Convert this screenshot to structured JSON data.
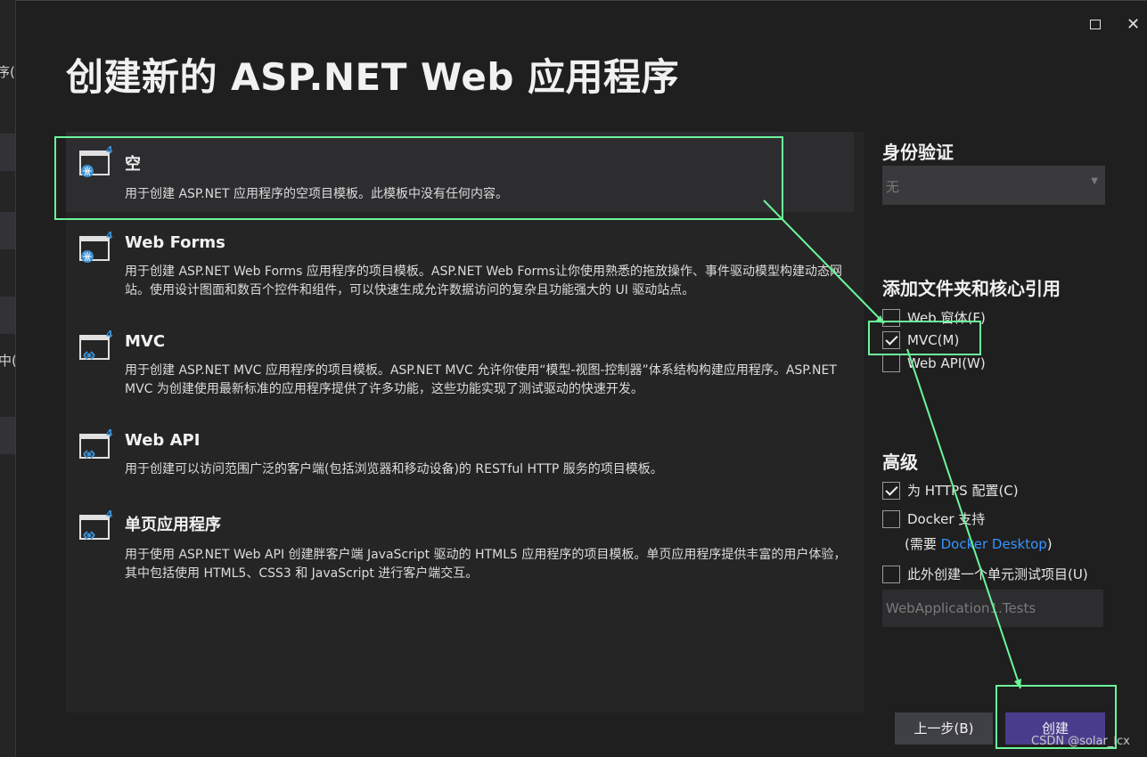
{
  "background_window": {
    "fragments": [
      "序(",
      "中("
    ]
  },
  "window_controls": {
    "maximize": "maximize-icon",
    "close": "✕"
  },
  "title": "创建新的 ASP.NET Web 应用程序",
  "templates": [
    {
      "name": "空",
      "desc": "用于创建 ASP.NET 应用程序的空项目模板。此模板中没有任何内容。",
      "selected": true
    },
    {
      "name": "Web Forms",
      "desc": "用于创建 ASP.NET Web Forms 应用程序的项目模板。ASP.NET Web Forms让你使用熟悉的拖放操作、事件驱动模型构建动态网站。使用设计图面和数百个控件和组件，可以快速生成允许数据访问的复杂且功能强大的 UI 驱动站点。"
    },
    {
      "name": "MVC",
      "desc": "用于创建 ASP.NET MVC 应用程序的项目模板。ASP.NET MVC 允许你使用“模型-视图-控制器”体系结构构建应用程序。ASP.NET MVC 为创建使用最新标准的应用程序提供了许多功能，这些功能实现了测试驱动的快速开发。"
    },
    {
      "name": "Web API",
      "desc": "用于创建可以访问范围广泛的客户端(包括浏览器和移动设备)的 RESTful HTTP 服务的项目模板。"
    },
    {
      "name": "单页应用程序",
      "desc": "用于使用 ASP.NET Web API 创建胖客户端 JavaScript 驱动的 HTML5 应用程序的项目模板。单页应用程序提供丰富的用户体验，其中包括使用 HTML5、CSS3 和 JavaScript 进行客户端交互。"
    }
  ],
  "template_icon_badge": "4",
  "auth": {
    "heading": "身份验证",
    "value": "无"
  },
  "folders": {
    "heading": "添加文件夹和核心引用",
    "options": [
      {
        "label": "Web 窗体(F)",
        "checked": false
      },
      {
        "label": "MVC(M)",
        "checked": true
      },
      {
        "label": "Web API(W)",
        "checked": false
      }
    ]
  },
  "advanced": {
    "heading": "高级",
    "https": {
      "label": "为 HTTPS 配置(C)",
      "checked": true
    },
    "docker": {
      "label": "Docker 支持",
      "checked": false
    },
    "docker_note_prefix": "(需要 ",
    "docker_note_link": "Docker Desktop",
    "docker_note_suffix": ")",
    "unit_test": {
      "label": "此外创建一个单元测试项目(U)",
      "checked": false
    },
    "test_project_name": "WebApplication1.Tests"
  },
  "buttons": {
    "back": "上一步(B)",
    "create": "创建"
  },
  "watermark": "CSDN @solar_lcx",
  "colors": {
    "accent": "#4a3c8c",
    "link": "#3794ff",
    "annotation": "#6cf59a"
  }
}
